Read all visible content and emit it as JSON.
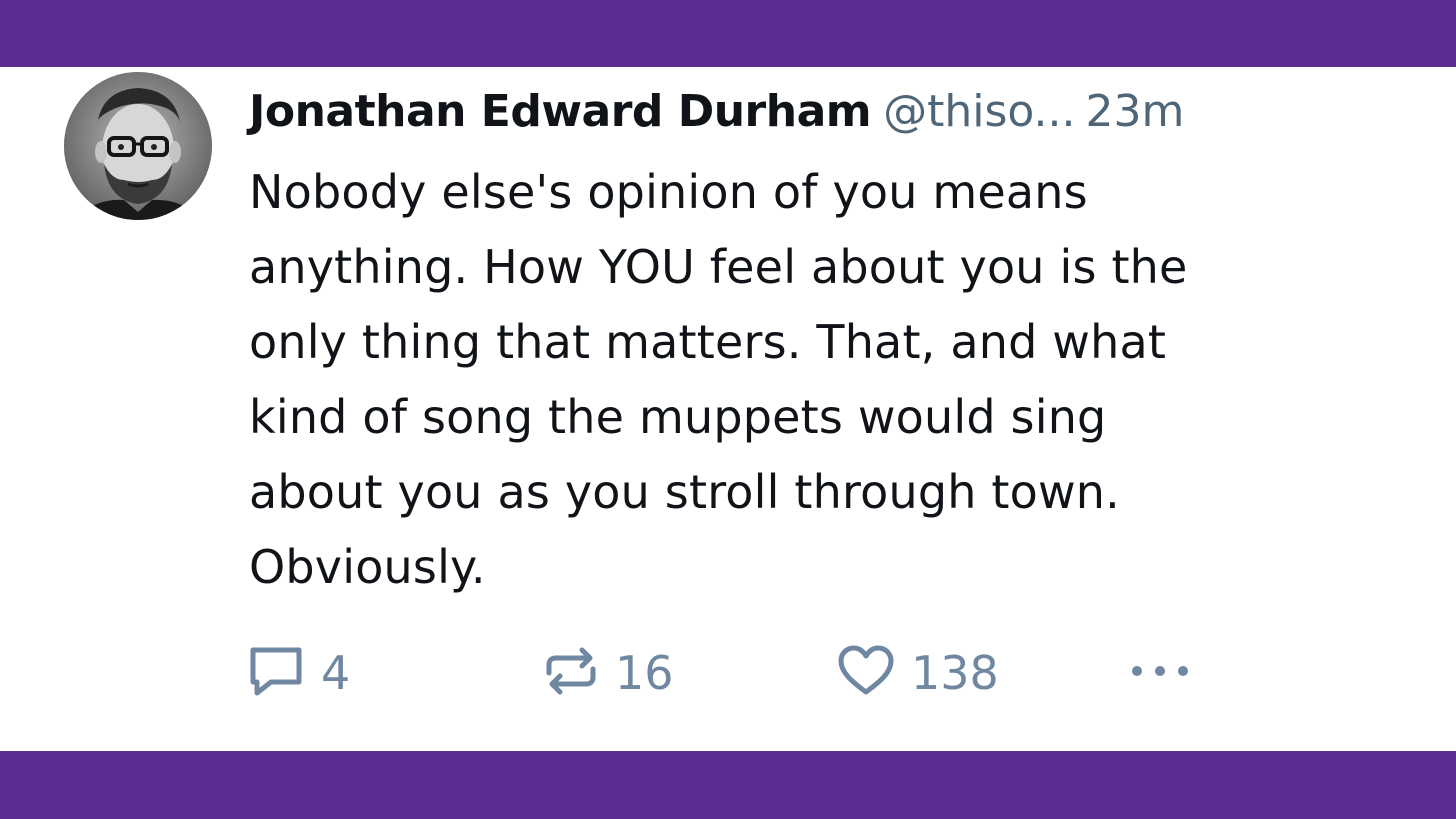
{
  "post": {
    "author_name": "Jonathan Edward Durham",
    "handle": "@thiso...",
    "time": "23m",
    "text": "Nobody else's opinion of you means\nanything. How YOU feel about you is the\nonly thing that matters. That, and what\nkind of song the muppets would sing\nabout you as you stroll through town.\nObviously."
  },
  "actions": {
    "reply": {
      "icon": "reply-icon",
      "count": "4"
    },
    "repost": {
      "icon": "repost-icon",
      "count": "16"
    },
    "like": {
      "icon": "heart-icon",
      "count": "138"
    },
    "more": {
      "icon": "more-icon"
    }
  },
  "colors": {
    "frame_background": "#5a2d91",
    "card_background": "#ffffff",
    "text": "#101418",
    "meta_text": "#4f6679",
    "action_icons": "#6f87a0"
  }
}
